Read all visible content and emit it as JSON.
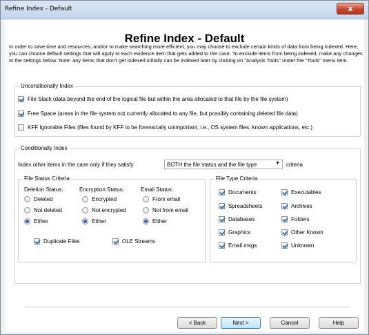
{
  "window": {
    "title": "Refine Index - Default",
    "close_glyph": "x"
  },
  "heading": "Refine Index - Default",
  "intro": "In order to save time and resources, and/or to make searching more efficient, you may choose to exclude certain kinds of data from being indexed. Here, you can choose default settings that will apply to each evidence item that gets added to the case. To exclude items from being indexed, make any changes to the settings below. Note: any items that don't get indexed initially can be indexed later by clicking on \"Analysis Tools\" under the \"Tools\" menu item.",
  "unconditional": {
    "label": "Unconditionally Index",
    "items": [
      {
        "label": "File Slack (data beyond the end of the logical file but within the area allocated to that file by the file system)",
        "checked": true
      },
      {
        "label": "Free Space (areas in the file system not currently allocated to any file, but possibly containing deleted file data)",
        "checked": true
      },
      {
        "label": "KFF Ignorable Files (files found by KFF to be forensically unimportant, i.e., OS system files, known applications, etc.)",
        "checked": false
      }
    ]
  },
  "conditional": {
    "label": "Conditionally Index",
    "criteria_prefix": "Index other items in the case only if they satisfy",
    "criteria_select": "BOTH the file status and the file type",
    "criteria_suffix": "criteria",
    "file_status": {
      "label": "File Status Criteria",
      "deletion": {
        "label": "Deletion Status:",
        "options": [
          "Deleted",
          "Not deleted",
          "Either"
        ],
        "selected": 2
      },
      "encryption": {
        "label": "Encryption Status:",
        "options": [
          "Encrypted",
          "Not encrypted",
          "Either"
        ],
        "selected": 2
      },
      "email": {
        "label": "Email Status:",
        "options": [
          "From email",
          "Not from email",
          "Either"
        ],
        "selected": 2
      },
      "duplicate": {
        "label": "Duplicate Files",
        "checked": true
      },
      "ole": {
        "label": "OLE Streams",
        "checked": true
      }
    },
    "file_type": {
      "label": "File Type Criteria",
      "items": [
        {
          "label": "Documents",
          "checked": true
        },
        {
          "label": "Executables",
          "checked": true
        },
        {
          "label": "Spreadsheets",
          "checked": true
        },
        {
          "label": "Archives",
          "checked": true
        },
        {
          "label": "Databases",
          "checked": true
        },
        {
          "label": "Folders",
          "checked": true
        },
        {
          "label": "Graphics",
          "checked": true
        },
        {
          "label": "Other Known",
          "checked": true
        },
        {
          "label": "Email msgs",
          "checked": true
        },
        {
          "label": "Unknown",
          "checked": true
        }
      ]
    }
  },
  "buttons": {
    "back": "< Back",
    "next": "Next >",
    "cancel": "Cancel",
    "help": "Help"
  }
}
